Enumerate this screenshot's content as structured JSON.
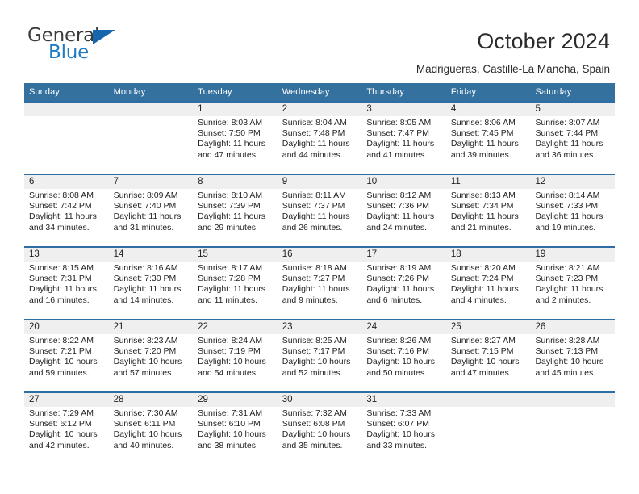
{
  "logo": {
    "word_one": "General",
    "word_two": "Blue",
    "triangle_icon": "triangle-icon"
  },
  "header": {
    "title": "October 2024",
    "subtitle": "Madrigueras, Castille-La Mancha, Spain"
  },
  "colors": {
    "header_blue": "#34719e",
    "row_rule_blue": "#2f6ea4",
    "day_band_gray": "#efefef",
    "logo_blue": "#1f7ac4",
    "text": "#231f20"
  },
  "calendar": {
    "weekdays": [
      "Sunday",
      "Monday",
      "Tuesday",
      "Wednesday",
      "Thursday",
      "Friday",
      "Saturday"
    ],
    "labels": {
      "sunrise": "Sunrise:",
      "sunset": "Sunset:",
      "daylight": "Daylight:"
    },
    "weeks": [
      [
        {
          "day": "",
          "sunrise": "",
          "sunset": "",
          "daylight": ""
        },
        {
          "day": "",
          "sunrise": "",
          "sunset": "",
          "daylight": ""
        },
        {
          "day": "1",
          "sunrise": "Sunrise: 8:03 AM",
          "sunset": "Sunset: 7:50 PM",
          "daylight": "Daylight: 11 hours and 47 minutes."
        },
        {
          "day": "2",
          "sunrise": "Sunrise: 8:04 AM",
          "sunset": "Sunset: 7:48 PM",
          "daylight": "Daylight: 11 hours and 44 minutes."
        },
        {
          "day": "3",
          "sunrise": "Sunrise: 8:05 AM",
          "sunset": "Sunset: 7:47 PM",
          "daylight": "Daylight: 11 hours and 41 minutes."
        },
        {
          "day": "4",
          "sunrise": "Sunrise: 8:06 AM",
          "sunset": "Sunset: 7:45 PM",
          "daylight": "Daylight: 11 hours and 39 minutes."
        },
        {
          "day": "5",
          "sunrise": "Sunrise: 8:07 AM",
          "sunset": "Sunset: 7:44 PM",
          "daylight": "Daylight: 11 hours and 36 minutes."
        }
      ],
      [
        {
          "day": "6",
          "sunrise": "Sunrise: 8:08 AM",
          "sunset": "Sunset: 7:42 PM",
          "daylight": "Daylight: 11 hours and 34 minutes."
        },
        {
          "day": "7",
          "sunrise": "Sunrise: 8:09 AM",
          "sunset": "Sunset: 7:40 PM",
          "daylight": "Daylight: 11 hours and 31 minutes."
        },
        {
          "day": "8",
          "sunrise": "Sunrise: 8:10 AM",
          "sunset": "Sunset: 7:39 PM",
          "daylight": "Daylight: 11 hours and 29 minutes."
        },
        {
          "day": "9",
          "sunrise": "Sunrise: 8:11 AM",
          "sunset": "Sunset: 7:37 PM",
          "daylight": "Daylight: 11 hours and 26 minutes."
        },
        {
          "day": "10",
          "sunrise": "Sunrise: 8:12 AM",
          "sunset": "Sunset: 7:36 PM",
          "daylight": "Daylight: 11 hours and 24 minutes."
        },
        {
          "day": "11",
          "sunrise": "Sunrise: 8:13 AM",
          "sunset": "Sunset: 7:34 PM",
          "daylight": "Daylight: 11 hours and 21 minutes."
        },
        {
          "day": "12",
          "sunrise": "Sunrise: 8:14 AM",
          "sunset": "Sunset: 7:33 PM",
          "daylight": "Daylight: 11 hours and 19 minutes."
        }
      ],
      [
        {
          "day": "13",
          "sunrise": "Sunrise: 8:15 AM",
          "sunset": "Sunset: 7:31 PM",
          "daylight": "Daylight: 11 hours and 16 minutes."
        },
        {
          "day": "14",
          "sunrise": "Sunrise: 8:16 AM",
          "sunset": "Sunset: 7:30 PM",
          "daylight": "Daylight: 11 hours and 14 minutes."
        },
        {
          "day": "15",
          "sunrise": "Sunrise: 8:17 AM",
          "sunset": "Sunset: 7:28 PM",
          "daylight": "Daylight: 11 hours and 11 minutes."
        },
        {
          "day": "16",
          "sunrise": "Sunrise: 8:18 AM",
          "sunset": "Sunset: 7:27 PM",
          "daylight": "Daylight: 11 hours and 9 minutes."
        },
        {
          "day": "17",
          "sunrise": "Sunrise: 8:19 AM",
          "sunset": "Sunset: 7:26 PM",
          "daylight": "Daylight: 11 hours and 6 minutes."
        },
        {
          "day": "18",
          "sunrise": "Sunrise: 8:20 AM",
          "sunset": "Sunset: 7:24 PM",
          "daylight": "Daylight: 11 hours and 4 minutes."
        },
        {
          "day": "19",
          "sunrise": "Sunrise: 8:21 AM",
          "sunset": "Sunset: 7:23 PM",
          "daylight": "Daylight: 11 hours and 2 minutes."
        }
      ],
      [
        {
          "day": "20",
          "sunrise": "Sunrise: 8:22 AM",
          "sunset": "Sunset: 7:21 PM",
          "daylight": "Daylight: 10 hours and 59 minutes."
        },
        {
          "day": "21",
          "sunrise": "Sunrise: 8:23 AM",
          "sunset": "Sunset: 7:20 PM",
          "daylight": "Daylight: 10 hours and 57 minutes."
        },
        {
          "day": "22",
          "sunrise": "Sunrise: 8:24 AM",
          "sunset": "Sunset: 7:19 PM",
          "daylight": "Daylight: 10 hours and 54 minutes."
        },
        {
          "day": "23",
          "sunrise": "Sunrise: 8:25 AM",
          "sunset": "Sunset: 7:17 PM",
          "daylight": "Daylight: 10 hours and 52 minutes."
        },
        {
          "day": "24",
          "sunrise": "Sunrise: 8:26 AM",
          "sunset": "Sunset: 7:16 PM",
          "daylight": "Daylight: 10 hours and 50 minutes."
        },
        {
          "day": "25",
          "sunrise": "Sunrise: 8:27 AM",
          "sunset": "Sunset: 7:15 PM",
          "daylight": "Daylight: 10 hours and 47 minutes."
        },
        {
          "day": "26",
          "sunrise": "Sunrise: 8:28 AM",
          "sunset": "Sunset: 7:13 PM",
          "daylight": "Daylight: 10 hours and 45 minutes."
        }
      ],
      [
        {
          "day": "27",
          "sunrise": "Sunrise: 7:29 AM",
          "sunset": "Sunset: 6:12 PM",
          "daylight": "Daylight: 10 hours and 42 minutes."
        },
        {
          "day": "28",
          "sunrise": "Sunrise: 7:30 AM",
          "sunset": "Sunset: 6:11 PM",
          "daylight": "Daylight: 10 hours and 40 minutes."
        },
        {
          "day": "29",
          "sunrise": "Sunrise: 7:31 AM",
          "sunset": "Sunset: 6:10 PM",
          "daylight": "Daylight: 10 hours and 38 minutes."
        },
        {
          "day": "30",
          "sunrise": "Sunrise: 7:32 AM",
          "sunset": "Sunset: 6:08 PM",
          "daylight": "Daylight: 10 hours and 35 minutes."
        },
        {
          "day": "31",
          "sunrise": "Sunrise: 7:33 AM",
          "sunset": "Sunset: 6:07 PM",
          "daylight": "Daylight: 10 hours and 33 minutes."
        },
        {
          "day": "",
          "sunrise": "",
          "sunset": "",
          "daylight": ""
        },
        {
          "day": "",
          "sunrise": "",
          "sunset": "",
          "daylight": ""
        }
      ]
    ]
  }
}
